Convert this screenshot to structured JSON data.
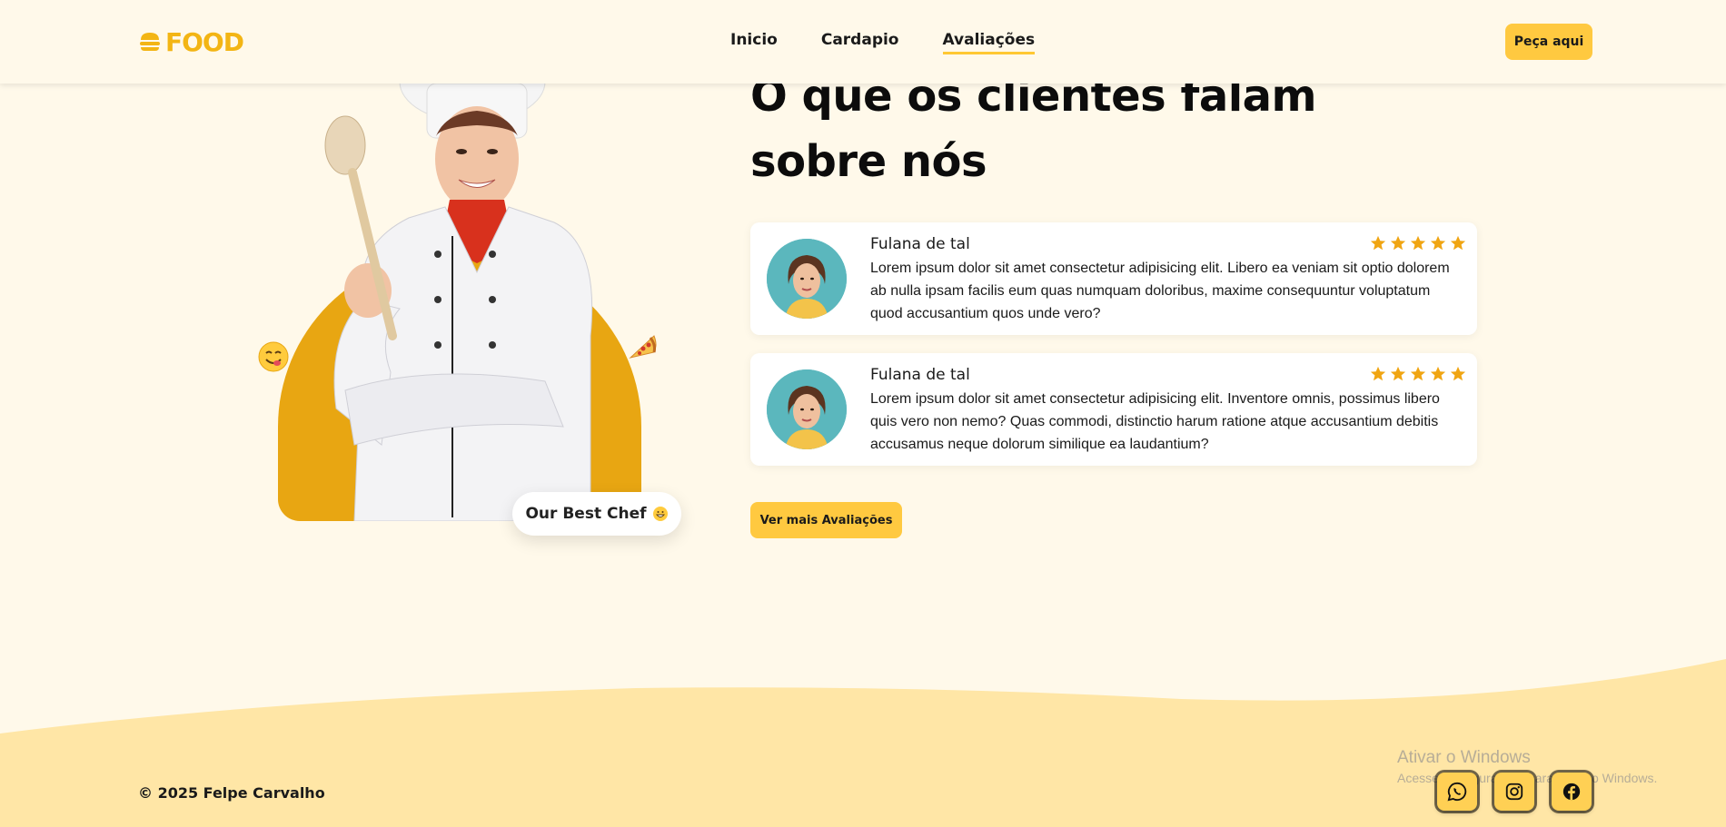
{
  "header": {
    "logo_text": "FOOD",
    "nav": [
      {
        "label": "Inicio",
        "active": false
      },
      {
        "label": "Cardapio",
        "active": false
      },
      {
        "label": "Avaliações",
        "active": true
      }
    ],
    "order_button": "Peça aqui"
  },
  "hero": {
    "badge_text": "Our Best Chef",
    "badge_emoji": "grinning-face-icon",
    "left_emoji": "yum-face-icon",
    "right_emoji": "pizza-icon"
  },
  "reviews": {
    "title": "O que os clientes falam sobre nós",
    "items": [
      {
        "name": "Fulana de tal",
        "rating": 5,
        "text": "Lorem ipsum dolor sit amet consectetur adipisicing elit. Libero ea veniam sit optio dolorem ab nulla ipsam facilis eum quas numquam doloribus, maxime consequuntur voluptatum quod accusantium quos unde vero?"
      },
      {
        "name": "Fulana de tal",
        "rating": 5,
        "text": "Lorem ipsum dolor sit amet consectetur adipisicing elit. Inventore omnis, possimus libero quis vero non nemo? Quas commodi, distinctio harum ratione atque accusantium debitis accusamus neque dolorum similique ea laudantium?"
      }
    ],
    "more_button": "Ver mais Avaliações"
  },
  "footer": {
    "copyright": "© 2025 Felpe Carvalho",
    "social": [
      "whatsapp-icon",
      "instagram-icon",
      "facebook-icon"
    ]
  },
  "watermark": {
    "line1": "Ativar o Windows",
    "line2": "Acesse Configurações para ativar o Windows."
  },
  "colors": {
    "background": "#fff9ea",
    "accent": "#ffc940",
    "arch": "#e8a612",
    "star": "#f0a512",
    "wave": "#ffe6a6"
  }
}
